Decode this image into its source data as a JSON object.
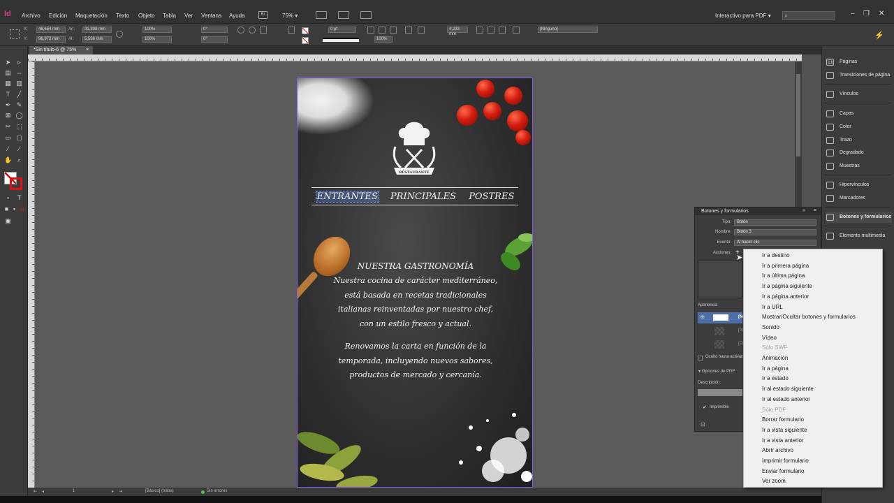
{
  "app": {
    "logo": "Id",
    "menu": [
      "Archivo",
      "Edición",
      "Maquetación",
      "Texto",
      "Objeto",
      "Tabla",
      "Ver",
      "Ventana",
      "Ayuda"
    ],
    "bridge_badge": "Br",
    "zoom": "75%",
    "workspace": "Interactivo para PDF",
    "window_controls": [
      "–",
      "❐",
      "✕"
    ]
  },
  "control_bar": {
    "x": "46,654 mm",
    "y": "96,972 mm",
    "w": "31,308 mm",
    "h": "5,556 mm",
    "scale_x": "100%",
    "scale_y": "100%",
    "rotation": "0°",
    "shear": "0°",
    "stroke_weight": "0 pt",
    "offset": "4,233 mm",
    "opacity": "100%",
    "object_style": "[Ninguno]"
  },
  "document": {
    "tab_label": "*Sin título-6 @ 75%",
    "tab_close": "×"
  },
  "status_bar": {
    "page": "1",
    "master": "[Básico] (traba)",
    "preflight": "Sin errores"
  },
  "artwork": {
    "logo_ribbon": "RESTAURANTE",
    "nav": [
      "ENTRANTES",
      "PRINCIPALES",
      "POSTRES"
    ],
    "heading": "NUESTRA GASTRONOMÍA",
    "paragraph1": [
      "Nuestra cocina de carácter mediterráneo,",
      "está basada en recetas tradicionales",
      "italianas reinventadas por nuestro chef,",
      "con un estilo fresco y actual."
    ],
    "paragraph2": [
      "Renovamos la carta en función de la",
      "temporada, incluyendo nuevos sabores,",
      "productos de mercado y cercanía."
    ]
  },
  "buttons_panel": {
    "title": "Botones y formularios",
    "tipo_label": "Tipo:",
    "tipo_value": "Botón",
    "nombre_label": "Nombre:",
    "nombre_value": "Botón 3",
    "evento_label": "Evento:",
    "evento_value": "Al hacer clic",
    "acciones_label": "Acciones:",
    "add_action": "+",
    "apariencia_label": "Apariencia",
    "state_normal": "[Normal]",
    "state_rollover": "[Al...]",
    "state_click": "[Cl...]",
    "hidden_until": "Oculto hasta activarse",
    "pdf_options": "Opciones de PDF",
    "descripcion_label": "Descripción:",
    "imprimible": "Imprimible"
  },
  "right_dock": [
    "Páginas",
    "Transiciones de página",
    "Vínculos",
    "Capas",
    "Color",
    "Trazo",
    "Degradado",
    "Muestras",
    "Hipervínculos",
    "Marcadores",
    "Botones y formularios",
    "Elemento multimedia"
  ],
  "actions_menu": [
    {
      "label": "Ir a destino",
      "enabled": true
    },
    {
      "label": "Ir a primera página",
      "enabled": true
    },
    {
      "label": "Ir a última página",
      "enabled": true
    },
    {
      "label": "Ir a página siguiente",
      "enabled": true
    },
    {
      "label": "Ir a página anterior",
      "enabled": true
    },
    {
      "label": "Ir a URL",
      "enabled": true
    },
    {
      "label": "Mostrar/Ocultar botones y formularios",
      "enabled": true
    },
    {
      "label": "Sonido",
      "enabled": true
    },
    {
      "label": "Vídeo",
      "enabled": true
    },
    {
      "label": "Sólo SWF",
      "enabled": false
    },
    {
      "label": "Animación",
      "enabled": true
    },
    {
      "label": "Ir a página",
      "enabled": true
    },
    {
      "label": "Ir a estado",
      "enabled": true
    },
    {
      "label": "Ir al estado siguiente",
      "enabled": true
    },
    {
      "label": "Ir al estado anterior",
      "enabled": true
    },
    {
      "label": "Sólo PDF",
      "enabled": false
    },
    {
      "label": "Borrar formulario",
      "enabled": true
    },
    {
      "label": "Ir a vista siguiente",
      "enabled": true
    },
    {
      "label": "Ir a vista anterior",
      "enabled": true
    },
    {
      "label": "Abrir archivo",
      "enabled": true
    },
    {
      "label": "Imprimir formulario",
      "enabled": true
    },
    {
      "label": "Enviar formulario",
      "enabled": true
    },
    {
      "label": "Ver zoom",
      "enabled": true
    }
  ],
  "colors": {
    "accent_logo": "#d43c8a",
    "chalkboard": "#2e2e2e",
    "selection": "#8a5cf0",
    "menu_bg": "#f0f0f0"
  }
}
